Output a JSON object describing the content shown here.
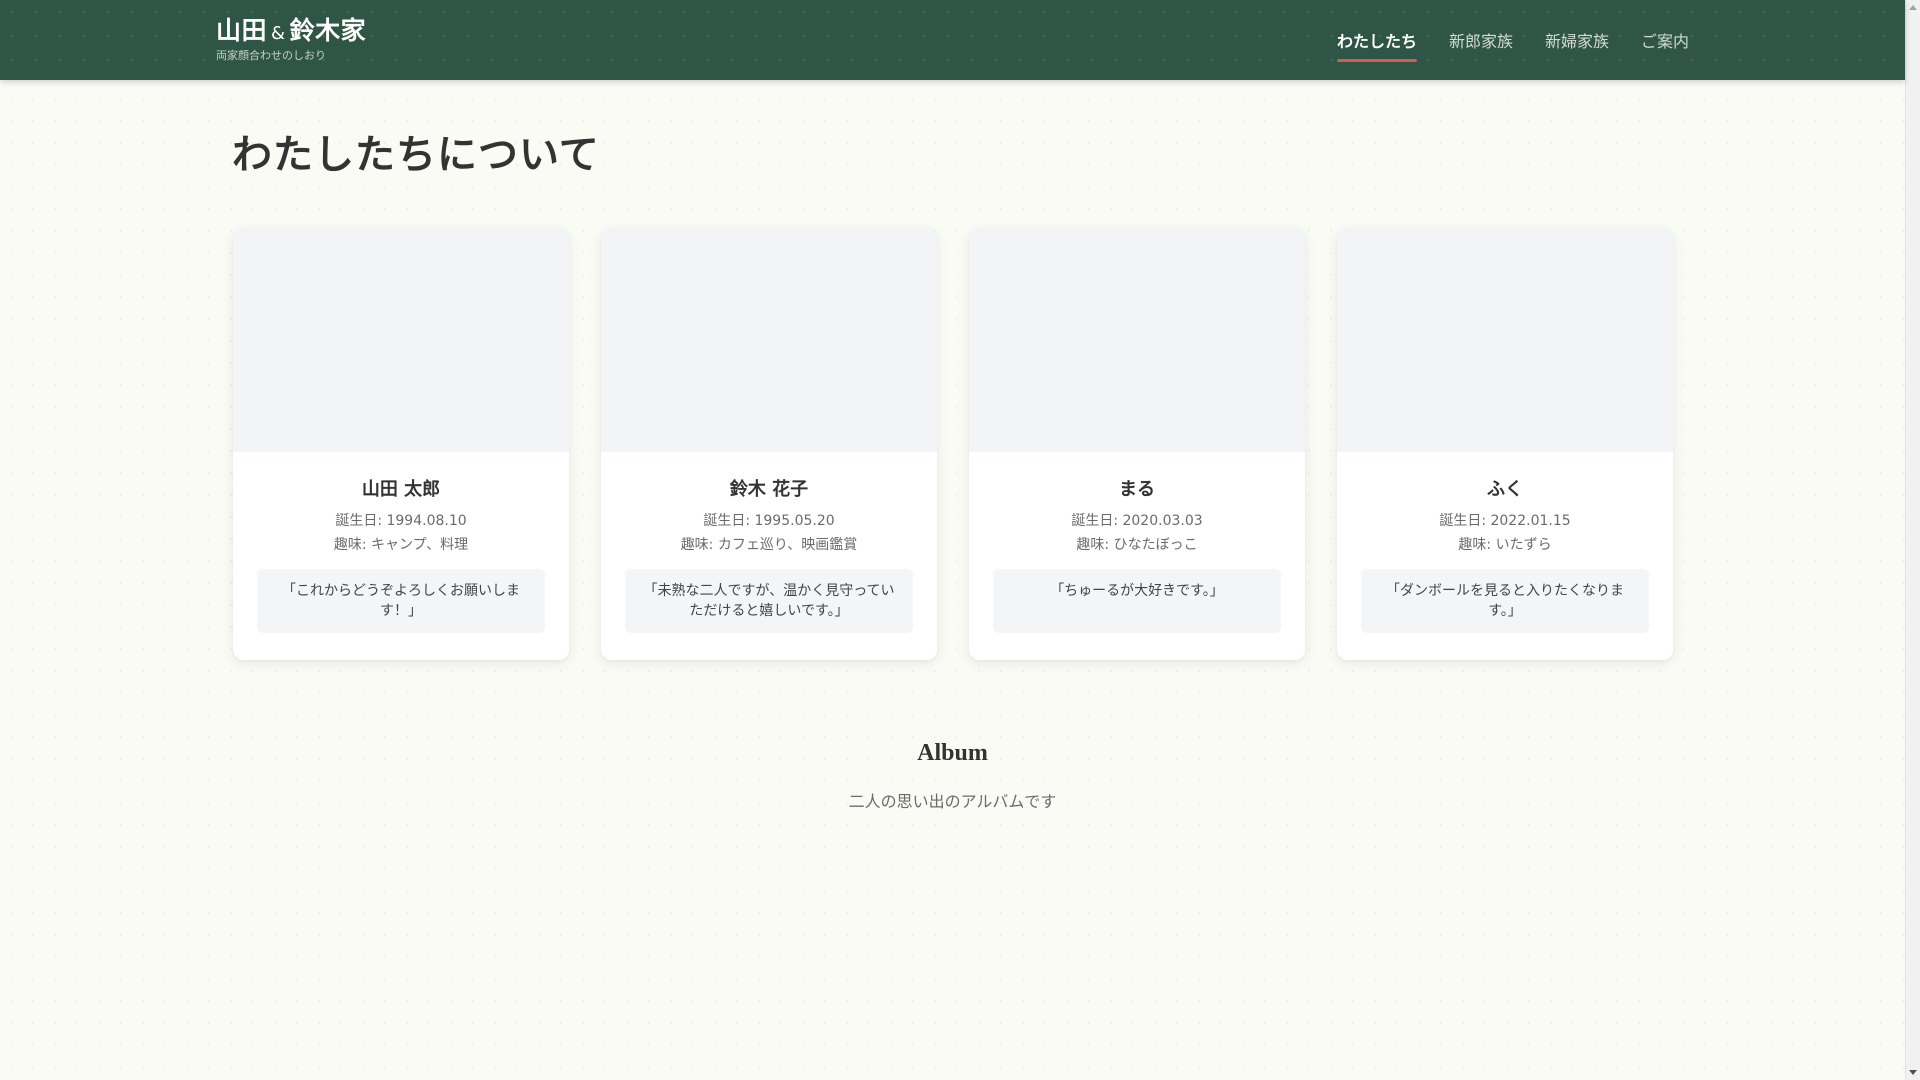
{
  "header": {
    "brand_left": "山田",
    "brand_amp": "&",
    "brand_right": "鈴木家",
    "subtitle": "両家顔合わせのしおり",
    "nav": [
      {
        "label": "わたしたち",
        "active": true
      },
      {
        "label": "新郎家族",
        "active": false
      },
      {
        "label": "新婦家族",
        "active": false
      },
      {
        "label": "ご案内",
        "active": false
      }
    ]
  },
  "section": {
    "title": "わたしたちについて"
  },
  "cards": [
    {
      "name": "山田 太郎",
      "birth": "誕生日: 1994.08.10",
      "hobby": "趣味: キャンプ、料理",
      "message": "「これからどうぞよろしくお願いします！」"
    },
    {
      "name": "鈴木 花子",
      "birth": "誕生日: 1995.05.20",
      "hobby": "趣味: カフェ巡り、映画鑑賞",
      "message": "「未熟な二人ですが、温かく見守っていただけると嬉しいです。」"
    },
    {
      "name": "まる",
      "birth": "誕生日: 2020.03.03",
      "hobby": "趣味: ひなたぼっこ",
      "message": "「ちゅーるが大好きです。」"
    },
    {
      "name": "ふく",
      "birth": "誕生日: 2022.01.15",
      "hobby": "趣味: いたずら",
      "message": "「ダンボールを見ると入りたくなります。」"
    }
  ],
  "album": {
    "title": "Album",
    "subtitle": "二人の思い出のアルバムです"
  },
  "colors": {
    "header_bg": "#2e5546",
    "nav_active_underline": "#d45a5a",
    "page_bg": "#fbfbf6",
    "card_photo_bg": "#f3f4f6",
    "message_bg": "#f4f5f7"
  }
}
